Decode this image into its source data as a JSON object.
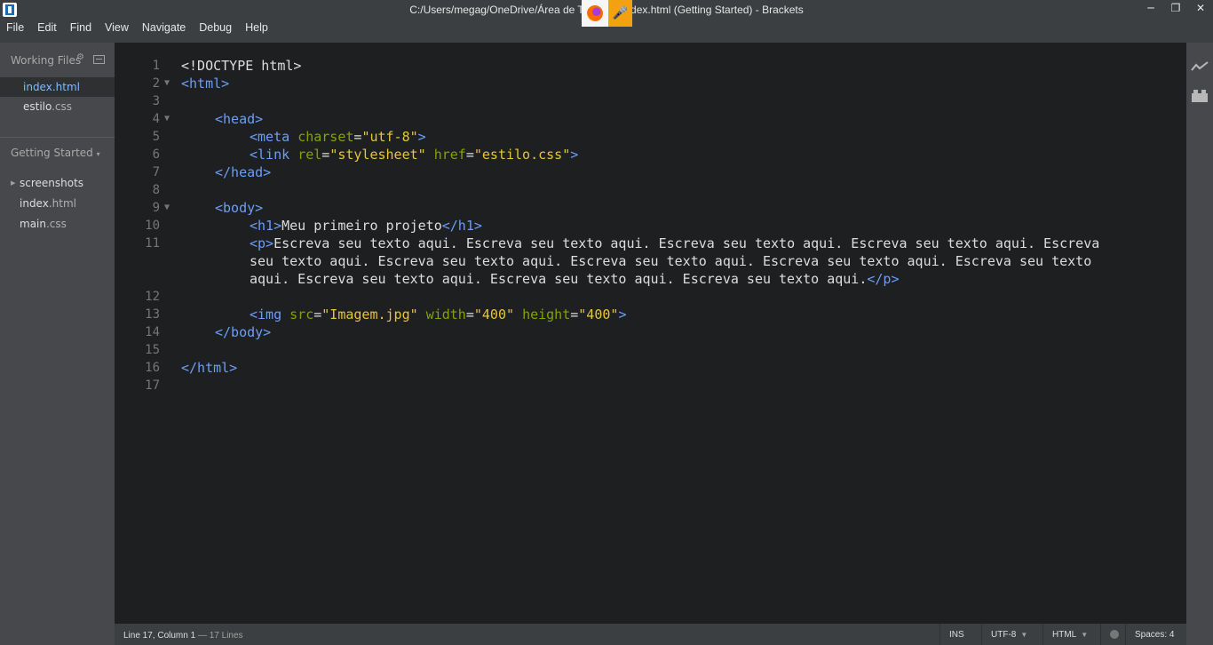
{
  "window": {
    "title": "C:/Users/megag/OneDrive/Área de Trabalho/index.html (Getting Started) - Brackets",
    "minimize": "─",
    "maximize": "❐",
    "close": "✕"
  },
  "menu": [
    "File",
    "Edit",
    "Find",
    "View",
    "Navigate",
    "Debug",
    "Help"
  ],
  "sidebar": {
    "working_files_header": "Working Files",
    "working_files": [
      {
        "name": "index",
        "ext": ".html",
        "active": true
      },
      {
        "name": "estilo",
        "ext": ".css",
        "active": false
      }
    ],
    "project_header": "Getting Started",
    "project_caret": "▾",
    "tree": [
      {
        "name": "screenshots",
        "ext": "",
        "folder": true
      },
      {
        "name": "index",
        "ext": ".html",
        "folder": false
      },
      {
        "name": "main",
        "ext": ".css",
        "folder": false
      }
    ]
  },
  "editor": {
    "line_numbers": [
      "1",
      "2",
      "3",
      "4",
      "5",
      "6",
      "7",
      "8",
      "9",
      "10",
      "11",
      "12",
      "13",
      "14",
      "15",
      "16",
      "17"
    ],
    "line1": "<!DOCTYPE html>",
    "line2": "<html>",
    "line4": "<head>",
    "line5": {
      "open": "<meta",
      "attr": "charset",
      "eq": "=",
      "val": "\"utf-8\"",
      "close": ">"
    },
    "line6": {
      "open": "<link",
      "attr1": "rel",
      "val1": "\"stylesheet\"",
      "attr2": "href",
      "val2": "\"estilo.css\"",
      "close": ">"
    },
    "line7": "</head>",
    "line9": "<body>",
    "line10": {
      "open": "<h1>",
      "text": "Meu primeiro projeto",
      "close": "</h1>"
    },
    "line11": {
      "open": "<p>",
      "wrap1": "Escreva seu texto aqui. Escreva seu texto aqui. Escreva seu texto aqui. Escreva seu texto aqui. Escreva",
      "wrap2": "seu texto aqui. Escreva seu texto aqui. Escreva seu texto aqui. Escreva seu texto aqui. Escreva seu texto",
      "wrap3": "aqui. Escreva seu texto aqui. Escreva seu texto aqui. Escreva seu texto aqui.",
      "close": "</p>"
    },
    "line13": {
      "open": "<img",
      "attr1": "src",
      "val1": "\"Imagem.jpg\"",
      "attr2": "width",
      "val2": "\"400\"",
      "attr3": "height",
      "val3": "\"400\"",
      "close": ">"
    },
    "line14": "</body>",
    "line16": "</html>"
  },
  "statusbar": {
    "cursor": "Line 17, Column 1",
    "separator": " — ",
    "lines": "17 Lines",
    "mode": "INS",
    "encoding": "UTF-8",
    "language": "HTML",
    "spaces_label": "Spaces:",
    "spaces_value": "4"
  },
  "icons": {
    "fold_open": "▼",
    "caret_down": "▼",
    "folder_arrow": "▶"
  },
  "colors": {
    "tag": "#6c9ef8",
    "attribute": "#85a300",
    "string": "#e7c53c",
    "active_file": "#7dbcff"
  }
}
